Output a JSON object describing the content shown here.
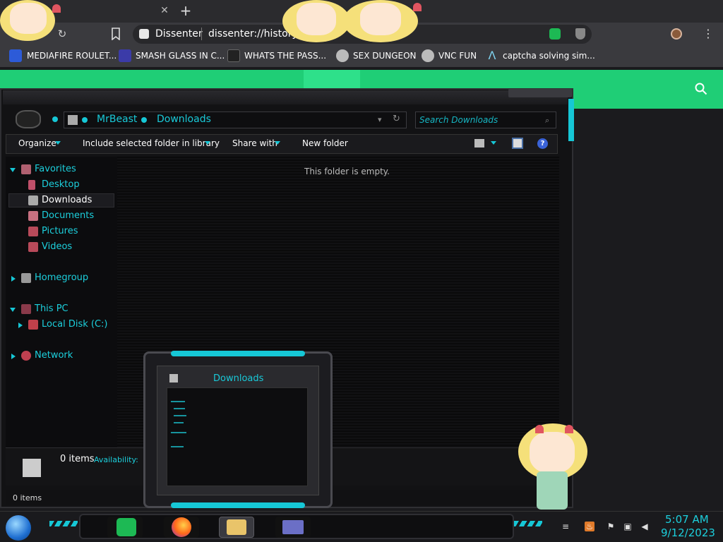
{
  "browser": {
    "url_site": "Dissenter",
    "url_path": "dissenter://history",
    "bookmarks": [
      {
        "label": "MEDIAFIRE ROULET...",
        "icon": "mediafire-icon"
      },
      {
        "label": "SMASH GLASS IN C...",
        "icon": "chevron-logo-icon"
      },
      {
        "label": "WHATS THE PASS...",
        "icon": "hat-icon"
      },
      {
        "label": "SEX DUNGEON",
        "icon": "gear-icon"
      },
      {
        "label": "VNC FUN",
        "icon": "gear-icon"
      },
      {
        "label": "captcha solving sim...",
        "icon": "lambda-icon"
      }
    ]
  },
  "explorer": {
    "breadcrumb": [
      "MrBeast",
      "Downloads"
    ],
    "search_placeholder": "Search Downloads",
    "commands": {
      "organize": "Organize",
      "include": "Include selected folder in library",
      "share": "Share with",
      "new_folder": "New folder"
    },
    "empty_message": "This folder is empty.",
    "nav": {
      "favorites": "Favorites",
      "desktop": "Desktop",
      "downloads": "Downloads",
      "documents": "Documents",
      "pictures": "Pictures",
      "videos": "Videos",
      "homegroup": "Homegroup",
      "this_pc": "This PC",
      "local_disk": "Local Disk (C:)",
      "network": "Network"
    },
    "details_count": "0 items",
    "details_availability": "Availability:",
    "status_text": "0 items"
  },
  "thumbnail": {
    "title": "Downloads"
  },
  "taskbar": {
    "time": "5:07 AM",
    "date": "9/12/2023"
  },
  "colors": {
    "accent": "#16c7d6",
    "page_green": "#1fce76",
    "window_bg": "#121214"
  }
}
